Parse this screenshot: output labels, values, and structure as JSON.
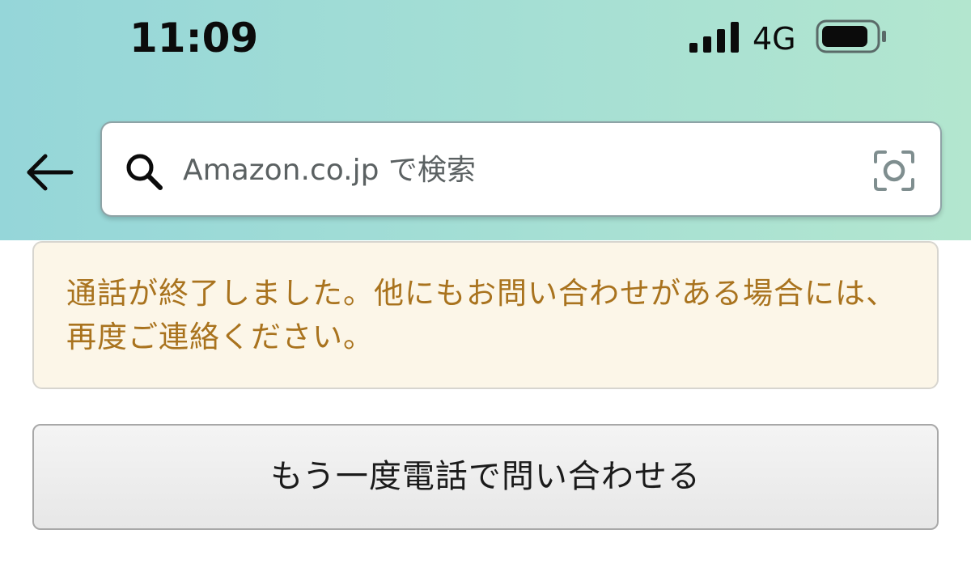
{
  "status_bar": {
    "time": "11:09",
    "network": "4G",
    "icons": [
      "signal-bars-icon",
      "battery-icon"
    ]
  },
  "search": {
    "placeholder": "Amazon.co.jp で検索",
    "icons": [
      "back-arrow-icon",
      "search-icon",
      "camera-scan-icon"
    ]
  },
  "alert": {
    "message": "通話が終了しました。他にもお問い合わせがある場合には、再度ご連絡ください。"
  },
  "actions": {
    "call_again_label": "もう一度電話で問い合わせる"
  },
  "colors": {
    "header_start": "#95d6d9",
    "header_end": "#b3e6cf",
    "alert_background": "#fcf6e8",
    "alert_text": "#a9731e"
  }
}
